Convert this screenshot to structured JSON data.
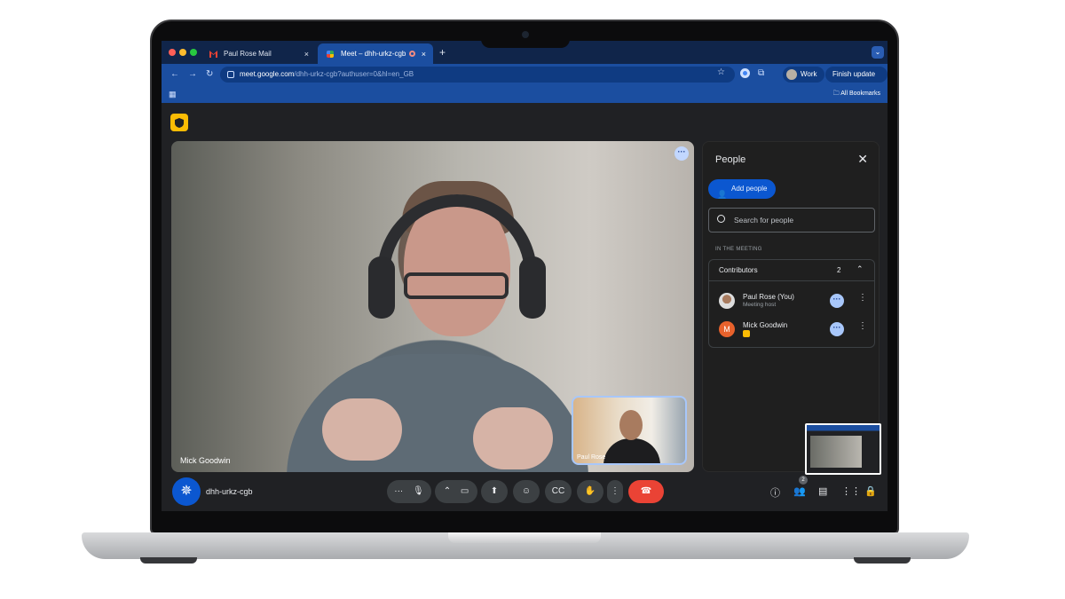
{
  "browser": {
    "tabs": [
      {
        "label": "Paul Rose Mail"
      },
      {
        "label": "Meet – dhh-urkz-cgb"
      }
    ],
    "url_host": "meet.google.com",
    "url_path": "/dhh-urkz-cgb?authuser=0&hl=en_GB",
    "profile_label": "Work",
    "finish_update_label": "Finish update",
    "all_bookmarks_label": "All Bookmarks"
  },
  "meet": {
    "speaker_name": "Mick Goodwin",
    "pip_name": "Paul Rose",
    "meeting_code": "dhh-urkz-cgb",
    "people_count_badge": "2"
  },
  "people_panel": {
    "title": "People",
    "add_people_label": "Add people",
    "search_placeholder": "Search for people",
    "section_label": "IN THE MEETING",
    "group_label": "Contributors",
    "group_count": "2",
    "participants": [
      {
        "name": "Paul Rose (You)",
        "subtitle": "Meeting host"
      },
      {
        "name": "Mick Goodwin",
        "initial": "M"
      }
    ]
  },
  "colors": {
    "accent": "#0b57d0",
    "hangup": "#ea4335",
    "shield": "#fbbc04",
    "avatar_m": "#e8622c"
  }
}
